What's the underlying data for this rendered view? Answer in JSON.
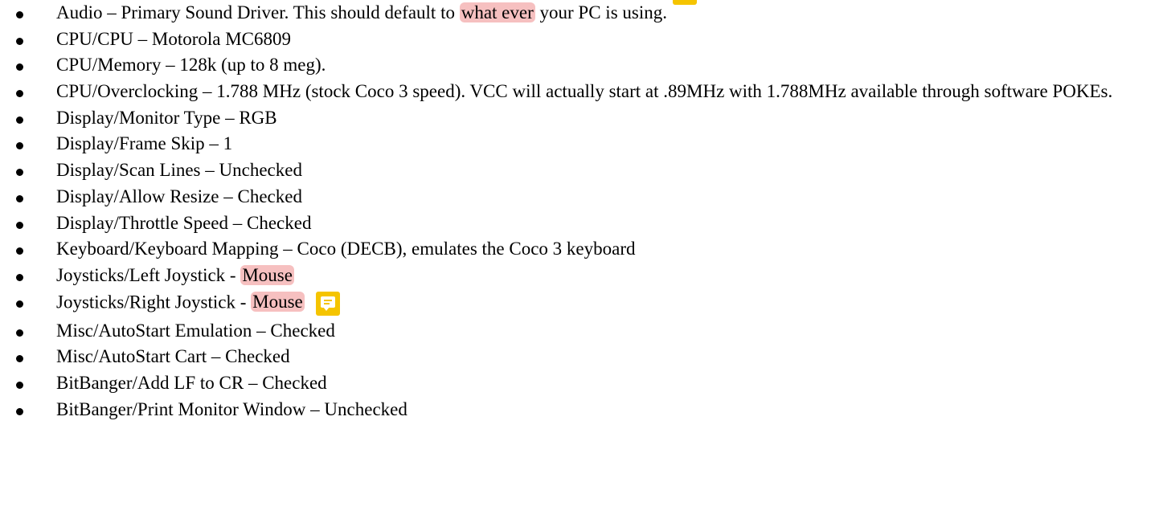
{
  "items": [
    {
      "pre": "Audio – Primary Sound Driver. This should default to ",
      "highlight": "what ever",
      "post": " your PC is using."
    },
    {
      "text": "CPU/CPU – Motorola MC6809"
    },
    {
      "text": "CPU/Memory – 128k (up to 8 meg)."
    },
    {
      "text": "CPU/Overclocking – 1.788 MHz (stock Coco 3 speed). VCC will actually start at .89MHz with 1.788MHz available through software POKEs."
    },
    {
      "text": "Display/Monitor Type – RGB"
    },
    {
      "text": "Display/Frame Skip – 1"
    },
    {
      "text": "Display/Scan Lines – Unchecked"
    },
    {
      "text": "Display/Allow Resize – Checked"
    },
    {
      "text": "Display/Throttle Speed – Checked"
    },
    {
      "text": "Keyboard/Keyboard Mapping – Coco (DECB), emulates the Coco 3 keyboard"
    },
    {
      "pre": "Joysticks/Left Joystick - ",
      "highlight": "Mouse"
    },
    {
      "pre": "Joysticks/Right Joystick - ",
      "highlight": "Mouse"
    },
    {
      "text": "Misc/AutoStart Emulation – Checked"
    },
    {
      "text": "Misc/AutoStart Cart – Checked"
    },
    {
      "text": "BitBanger/Add LF to CR – Checked"
    },
    {
      "text": "BitBanger/Print Monitor Window – Unchecked"
    }
  ],
  "comment_icon": "comment-icon",
  "colors": {
    "highlight": "#f6c0c0",
    "comment_icon": "#f5c400",
    "text": "#000000",
    "background": "#ffffff"
  }
}
